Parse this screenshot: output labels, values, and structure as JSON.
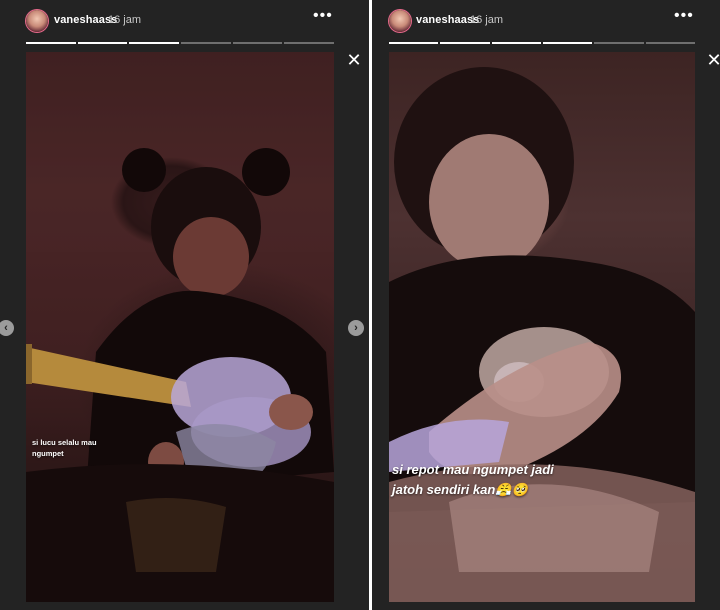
{
  "stories": [
    {
      "username": "vaneshaass",
      "time": "16 jam",
      "more_glyph": "•••",
      "caption": "si lucu selalu mau ngumpet",
      "progress": {
        "segments": 6,
        "completed": 3
      }
    },
    {
      "username": "vaneshaass",
      "time": "16 jam",
      "more_glyph": "•••",
      "caption": "si repot mau ngumpet jadi jatoh sendiri kan😤🥺",
      "progress": {
        "segments": 6,
        "completed": 4
      }
    }
  ],
  "controls": {
    "close_glyph": "✕",
    "prev_glyph": "‹",
    "next_glyph": "›"
  },
  "icons": {
    "avatar": "avatar-image",
    "more": "more-options-icon",
    "close": "close-icon",
    "prev": "chevron-left-icon",
    "next": "chevron-right-icon"
  },
  "colors": {
    "panel_bg": "#232323",
    "text": "#ffffff",
    "subtext": "#c8c8c8",
    "avatar_ring": "#e86a8c"
  }
}
